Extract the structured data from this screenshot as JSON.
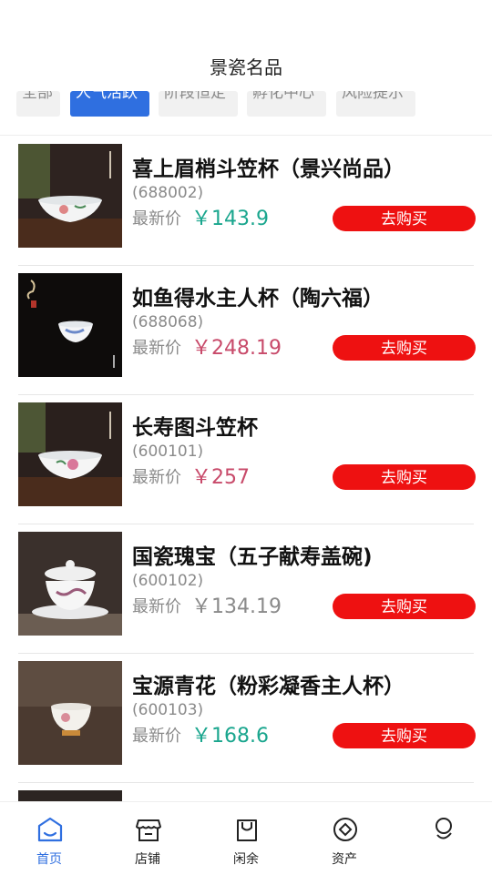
{
  "header": {
    "title": "景瓷名品"
  },
  "tabs": [
    {
      "label": "全部",
      "active": false
    },
    {
      "label": "人气活跃",
      "active": true
    },
    {
      "label": "阶段恒定",
      "active": false
    },
    {
      "label": "孵化中心",
      "active": false
    },
    {
      "label": "风险提示",
      "active": false
    }
  ],
  "products": [
    {
      "name": "喜上眉梢斗笠杯（景兴尚品）",
      "code": "(688002)",
      "price_label": "最新价",
      "price": "￥143.9",
      "price_color": "#1aa68e",
      "buy_label": "去购买"
    },
    {
      "name": "如鱼得水主人杯（陶六福）",
      "code": "(688068)",
      "price_label": "最新价",
      "price": "￥248.19",
      "price_color": "#c84a6a",
      "buy_label": "去购买"
    },
    {
      "name": "长寿图斗笠杯",
      "code": "(600101)",
      "price_label": "最新价",
      "price": "￥257",
      "price_color": "#c84a6a",
      "buy_label": "去购买"
    },
    {
      "name": "国瓷瑰宝（五子献寿盖碗)",
      "code": "(600102)",
      "price_label": "最新价",
      "price": "￥134.19",
      "price_color": "#8a8a8a",
      "buy_label": "去购买"
    },
    {
      "name": "宝源青花（粉彩凝香主人杯）",
      "code": "(600103)",
      "price_label": "最新价",
      "price": "￥168.6",
      "price_color": "#1aa68e",
      "buy_label": "去购买"
    }
  ],
  "tabbar": [
    {
      "label": "首页",
      "icon": "home-icon",
      "active": true
    },
    {
      "label": "店铺",
      "icon": "shop-icon",
      "active": false
    },
    {
      "label": "闲余",
      "icon": "bag-icon",
      "active": false
    },
    {
      "label": "资产",
      "icon": "asset-icon",
      "active": false
    },
    {
      "label": "",
      "icon": "profile-icon",
      "active": false
    }
  ],
  "colors": {
    "accent": "#2f6fe0",
    "buy_button": "#ee1111"
  }
}
